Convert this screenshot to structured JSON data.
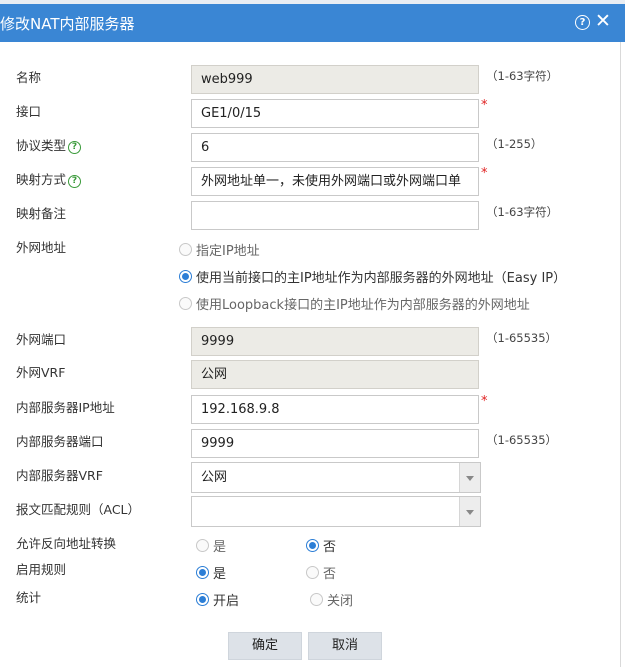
{
  "dialog": {
    "title": "修改NAT内部服务器",
    "help_icon": "?",
    "close_icon": "✕"
  },
  "fields": {
    "name": {
      "label": "名称",
      "value": "web999",
      "hint": "（1-63字符）"
    },
    "interface": {
      "label": "接口",
      "value": "GE1/0/15",
      "required": "*"
    },
    "protocol": {
      "label": "协议类型",
      "value": "6",
      "hint": "（1-255）"
    },
    "mapping": {
      "label": "映射方式",
      "value": "外网地址单一，未使用外网端口或外网端口单",
      "required": "*"
    },
    "remark": {
      "label": "映射备注",
      "value": "",
      "hint": "（1-63字符）"
    },
    "external_address": {
      "label": "外网地址",
      "options": [
        {
          "label": "指定IP地址",
          "selected": false
        },
        {
          "label": "使用当前接口的主IP地址作为内部服务器的外网地址（Easy IP）",
          "selected": true
        },
        {
          "label": "使用Loopback接口的主IP地址作为内部服务器的外网地址",
          "selected": false
        }
      ]
    },
    "external_port": {
      "label": "外网端口",
      "value": "9999",
      "hint": "（1-65535）"
    },
    "external_vrf": {
      "label": "外网VRF",
      "value": "公网"
    },
    "internal_ip": {
      "label": "内部服务器IP地址",
      "value": "192.168.9.8",
      "required": "*"
    },
    "internal_port": {
      "label": "内部服务器端口",
      "value": "9999",
      "hint": "（1-65535）"
    },
    "internal_vrf": {
      "label": "内部服务器VRF",
      "value": "公网"
    },
    "acl": {
      "label": "报文匹配规则（ACL）",
      "value": ""
    },
    "reverse": {
      "label": "允许反向地址转换",
      "yes": "是",
      "no": "否",
      "selected": "no"
    },
    "enable": {
      "label": "启用规则",
      "yes": "是",
      "no": "否",
      "selected": "yes"
    },
    "stats": {
      "label": "统计",
      "on": "开启",
      "off": "关闭",
      "selected": "on"
    }
  },
  "buttons": {
    "ok": "确定",
    "cancel": "取消"
  },
  "colors": {
    "title_bar": "#3a86d4",
    "accent": "#2c7ed6",
    "required": "#e02020",
    "help": "#3a9a3a"
  }
}
